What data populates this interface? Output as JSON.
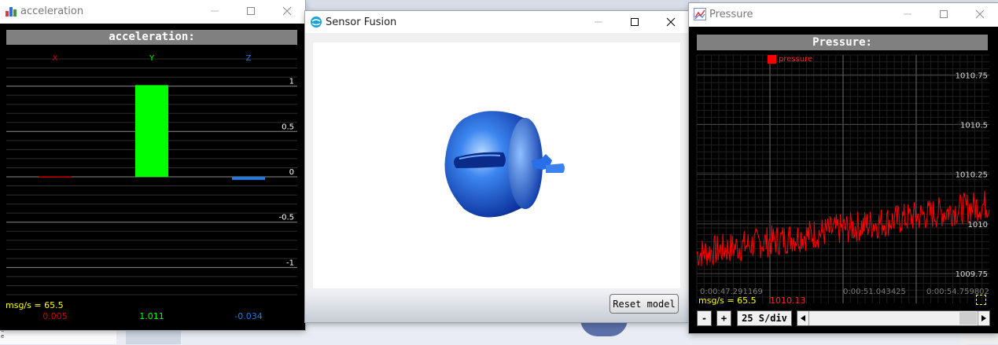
{
  "acceleration_window": {
    "title": "acceleration",
    "header": "acceleration:",
    "msg_rate": "msg/s = 65.5",
    "colors": {
      "x": "#cc0000",
      "y": "#00ff00",
      "z": "#1e7be0"
    },
    "chart_data": {
      "type": "bar",
      "categories": [
        "X",
        "Y",
        "Z"
      ],
      "values": [
        0.005,
        1.011,
        -0.034
      ],
      "value_labels": [
        "0.005",
        "1.011",
        "-0.034"
      ],
      "y_ticks": [
        "1",
        "0.5",
        "0",
        "-0.5",
        "-1"
      ],
      "ylim": [
        -1.3,
        1.3
      ],
      "grid": true
    }
  },
  "fusion_window": {
    "title": "Sensor Fusion",
    "reset_label": "Reset model",
    "model_color": "#1f5fd6"
  },
  "pressure_window": {
    "title": "Pressure",
    "header": "Pressure:",
    "legend_label": "pressure",
    "msg_rate": "msg/s = 65.5",
    "current_value": "1010.13",
    "minus_label": "-",
    "plus_label": "+",
    "timebase_label": "25 S/div",
    "line_color": "#ff0000",
    "chart_data": {
      "type": "line",
      "series": [
        {
          "name": "pressure"
        }
      ],
      "y_ticks": [
        "1010.75",
        "1010.5",
        "1010.25",
        "1010",
        "1009.75"
      ],
      "x_ticks": [
        "0:00:47.291169",
        "0:00:51.043425",
        "0:00:54.759802"
      ],
      "ylim": [
        1009.6,
        1010.85
      ],
      "x_range_s": [
        47.29,
        55.2
      ],
      "trend": {
        "start": 1009.85,
        "end": 1010.1,
        "noise": 0.08
      },
      "grid": true
    }
  }
}
